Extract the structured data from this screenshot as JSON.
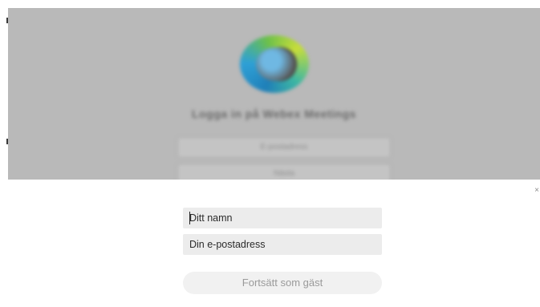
{
  "backdrop": {
    "title": "Logga in på Webex Meetings",
    "field1": "E-postadress",
    "field2": "Nästa"
  },
  "dialog": {
    "close_glyph": "×",
    "name_placeholder": "Ditt namn",
    "email_placeholder": "Din e-postadress",
    "guest_button": "Fortsätt som gäst"
  },
  "colors": {
    "backdrop": "#b9b9b9",
    "field_bg": "#ececec",
    "button_bg": "#f1f1f1",
    "button_text": "#9a9a9a"
  },
  "icons": {
    "logo": "webex-logo-icon",
    "close": "close-icon"
  }
}
